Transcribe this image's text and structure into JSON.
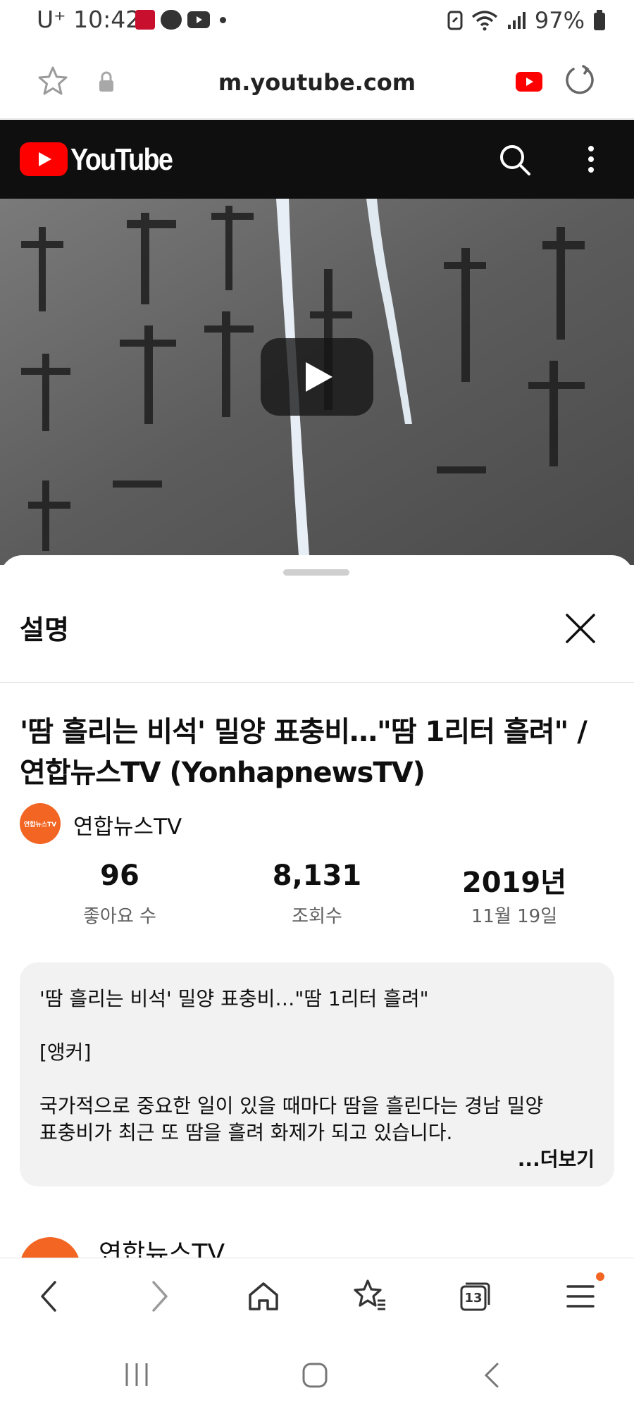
{
  "status_bar": {
    "carrier": "U⁺",
    "time": "10:42",
    "battery": "97%"
  },
  "browser": {
    "url": "m.youtube.com"
  },
  "youtube": {
    "logo_text": "YouTube"
  },
  "sheet": {
    "title": "설명",
    "video_title": "'땀 흘리는 비석' 밀양 표충비…\"땀 1리터 흘려\" / 연합뉴스TV (YonhapnewsTV)",
    "channel_name": "연합뉴스TV",
    "channel_avatar_text": "연합뉴스TV",
    "stats": {
      "likes_value": "96",
      "likes_label": "좋아요 수",
      "views_value": "8,131",
      "views_label": "조회수",
      "year_value": "2019년",
      "date_label": "11월 19일"
    },
    "description": {
      "line1": "'땀 흘리는 비석' 밀양 표충비…\"땀 1리터 흘려\"",
      "line2": "[앵커]",
      "line3": "국가적으로 중요한 일이 있을 때마다 땀을 흘린다는 경남 밀양",
      "line4": "표충비가 최근 또 땀을 흘려 화제가 되고 있습니다.",
      "more": "...더보기"
    },
    "next_channel_name": "연합뉴스TV"
  },
  "bottom_nav": {
    "tab_count": "13"
  },
  "colors": {
    "youtube_red": "#ff0000",
    "header_bg": "#0f0f0f",
    "channel_orange": "#f26522",
    "notification_dot": "#f26522"
  }
}
